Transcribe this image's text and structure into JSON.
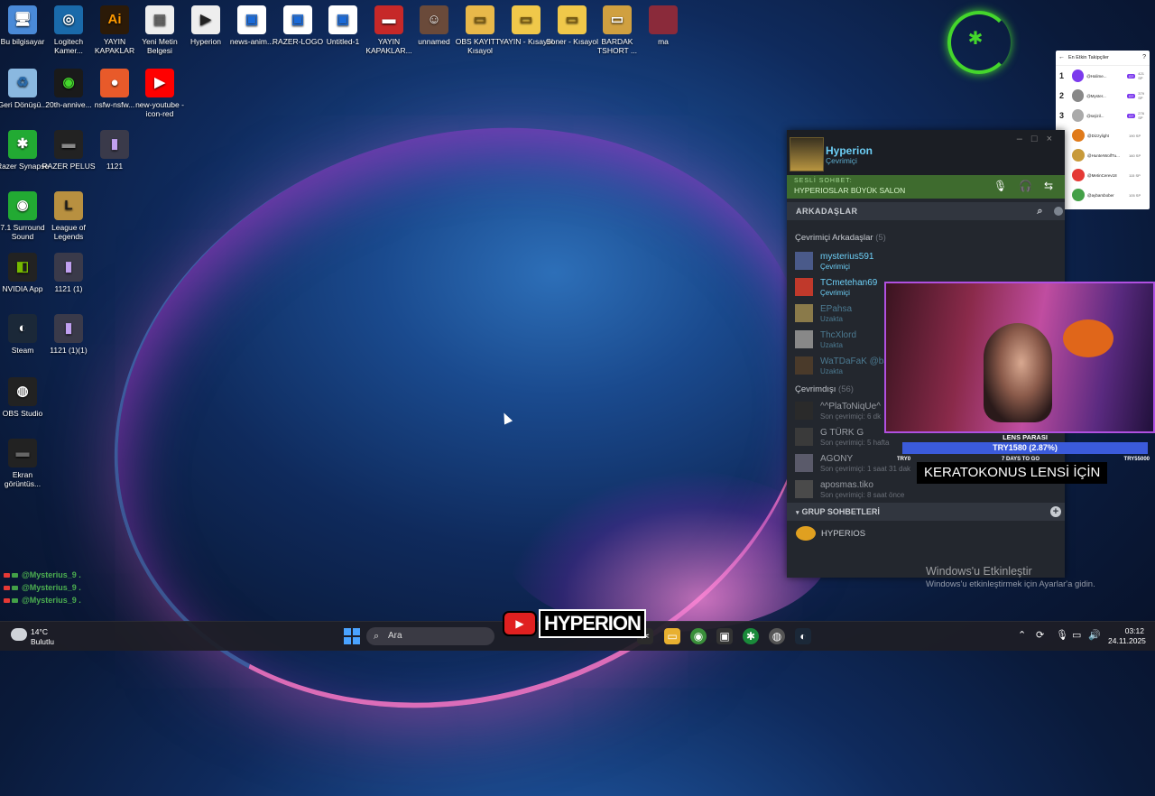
{
  "desktop": {
    "icons": [
      {
        "label": "Bu bilgisayar",
        "glyph": "🖥"
      },
      {
        "label": "Logitech Kamer...",
        "glyph": "◎"
      },
      {
        "label": "YAYIN KAPAKLAR",
        "glyph": "Ai"
      },
      {
        "label": "Yeni Metin Belgesi",
        "glyph": "▤"
      },
      {
        "label": "Hyperion",
        "glyph": "▶"
      },
      {
        "label": "news-anim...",
        "glyph": "▣"
      },
      {
        "label": "RAZER-LOGO",
        "glyph": "▣"
      },
      {
        "label": "Untitled-1",
        "glyph": "▣"
      },
      {
        "label": "YAYIN KAPAKLAR...",
        "glyph": "▬"
      },
      {
        "label": "unnamed",
        "glyph": "☺"
      },
      {
        "label": "OBS KAYITT - Kısayol",
        "glyph": "▭"
      },
      {
        "label": "YAYIN - Kısayol",
        "glyph": "▭"
      },
      {
        "label": "Soner - Kısayol",
        "glyph": "▭"
      },
      {
        "label": "BARDAK TSHORT ...",
        "glyph": "▭"
      },
      {
        "label": "ma",
        "glyph": ""
      },
      {
        "label": "Geri Dönüşü...",
        "glyph": "♻"
      },
      {
        "label": "20th-annive...",
        "glyph": "◉"
      },
      {
        "label": "nsfw-nsfw...",
        "glyph": "●"
      },
      {
        "label": "new-youtube -icon-red",
        "glyph": "▶"
      },
      {
        "label": "Razer Synapse",
        "glyph": "✱"
      },
      {
        "label": "RAZER PELUS",
        "glyph": "▬"
      },
      {
        "label": "1121",
        "glyph": "▮"
      },
      {
        "label": "7.1 Surround Sound",
        "glyph": "◉"
      },
      {
        "label": "League of Legends",
        "glyph": "L"
      },
      {
        "label": "NVIDIA App",
        "glyph": "◧"
      },
      {
        "label": "1121 (1)",
        "glyph": "▮"
      },
      {
        "label": "Steam",
        "glyph": "◐"
      },
      {
        "label": "1121 (1)(1)",
        "glyph": "▮"
      },
      {
        "label": "OBS Studio",
        "glyph": "◍"
      },
      {
        "label": "Ekran görüntüs...",
        "glyph": "▬"
      }
    ]
  },
  "followers": {
    "title": "En Etkin Takipçiler",
    "rows": [
      {
        "rank": "1",
        "name": "@Halime...",
        "badge": "G?",
        "points": "421 SP",
        "color": "#7c3aed"
      },
      {
        "rank": "2",
        "name": "@Myster...",
        "badge": "G?",
        "points": "379 SP",
        "color": "#888"
      },
      {
        "rank": "3",
        "name": "@sejizil...",
        "badge": "G?",
        "points": "276 SP",
        "color": "#aaa"
      },
      {
        "rank": "4",
        "name": "@Dizzylight",
        "badge": "",
        "points": "190 SP",
        "color": "#e07a1a"
      },
      {
        "rank": "5",
        "name": "@HunterWolfTu...",
        "badge": "",
        "points": "160 SP",
        "color": "#c89a3a"
      },
      {
        "rank": "6",
        "name": "@MetinCerev18",
        "badge": "",
        "points": "115 SP",
        "color": "#e53935"
      },
      {
        "rank": "7",
        "name": "@aybarsbober",
        "badge": "",
        "points": "105 SP",
        "color": "#43a047"
      }
    ]
  },
  "steam": {
    "user": {
      "name": "Hyperion",
      "status": "Çevrimiçi"
    },
    "voice": {
      "label": "SESLİ SOHBET:",
      "channel": "HYPERIOSLAR BÜYÜK SALON"
    },
    "friends_header": "ARKADAŞLAR",
    "online_section": {
      "title": "Çevrimiçi Arkadaşlar",
      "count": "(5)"
    },
    "online": [
      {
        "name": "mysterius591",
        "status": "Çevrimiçi",
        "state": "online",
        "avatar": "#4a5a8a"
      },
      {
        "name": "TCmetehan69",
        "status": "Çevrimiçi",
        "state": "online",
        "avatar": "#c0392b"
      },
      {
        "name": "EPahsa",
        "status": "Uzakta",
        "state": "away",
        "avatar": "#8a7a4a"
      },
      {
        "name": "ThcXlord",
        "status": "Uzakta",
        "state": "away",
        "avatar": "#888"
      },
      {
        "name": "WaTDaFaK @bab",
        "status": "Uzakta",
        "state": "away",
        "avatar": "#4a3a2a"
      }
    ],
    "offline_section": {
      "title": "Çevrimdışı",
      "count": "(56)"
    },
    "offline": [
      {
        "name": "^^PlaToNiqUe^",
        "status": "Son çevrimiçi: 6 dk",
        "avatar": "#2a2a2a"
      },
      {
        "name": "G TÜRK G",
        "status": "Son çevrimiçi: 5 hafta",
        "avatar": "#3a3a3a"
      },
      {
        "name": "AGONY",
        "status": "Son çevrimiçi: 1 saat 31 dak",
        "avatar": "#5a5a6a"
      },
      {
        "name": "aposmas.tiko",
        "status": "Son çevrimiçi: 8 saat önce",
        "avatar": "#4a4a4a"
      }
    ],
    "group_header": "GRUP SOHBETLERİ",
    "group": {
      "name": "HYPERIOS"
    }
  },
  "overlay": {
    "lens_title": "LENS PARASI",
    "lens_value": "TRY1580 (2.87%)",
    "lens_progress": 0.0287,
    "lens_left": "TRY0",
    "lens_mid": "7 DAYS TO GO",
    "lens_right": "TRY55000",
    "banner": "KERATOKONUS LENSİ İÇİN"
  },
  "activation": {
    "title": "Windows'u Etkinleştir",
    "subtitle": "Windows'u etkinleştirmek için Ayarlar'a gidin."
  },
  "chat": [
    {
      "user": "@Mysterius_9",
      "text": "."
    },
    {
      "user": "@Mysterius_9",
      "text": "."
    },
    {
      "user": "@Mysterius_9",
      "text": "."
    }
  ],
  "taskbar": {
    "weather_temp": "14°C",
    "weather_cond": "Bulutlu",
    "search_placeholder": "Ara",
    "stream_logo": "HYPERION",
    "time": "03:12",
    "date": "24.11.2025"
  }
}
